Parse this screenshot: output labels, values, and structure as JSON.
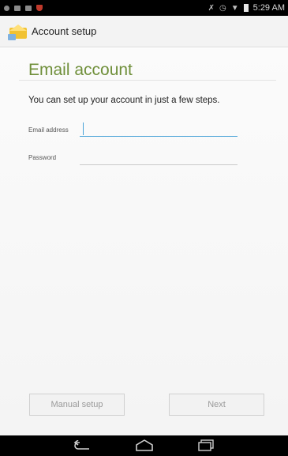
{
  "status_bar": {
    "time": "5:29 AM",
    "icons": [
      "notification-dot-icon",
      "notification-square-icon",
      "notification-square-icon",
      "shield-icon",
      "mute-icon",
      "alarm-icon",
      "wifi-icon",
      "battery-icon"
    ]
  },
  "action_bar": {
    "title": "Account setup",
    "icon": "email-app-icon"
  },
  "main": {
    "heading": "Email account",
    "intro": "You can set up your account in just a few steps.",
    "fields": {
      "email": {
        "label": "Email address",
        "value": "",
        "placeholder": ""
      },
      "password": {
        "label": "Password",
        "value": "",
        "placeholder": ""
      }
    }
  },
  "buttons": {
    "manual_setup": "Manual setup",
    "next": "Next"
  },
  "nav_bar": {
    "icons": [
      "back-icon",
      "home-icon",
      "recent-apps-icon"
    ]
  },
  "colors": {
    "heading": "#6f8f3a",
    "focus": "#49a3d8",
    "status_bar": "#000000"
  }
}
